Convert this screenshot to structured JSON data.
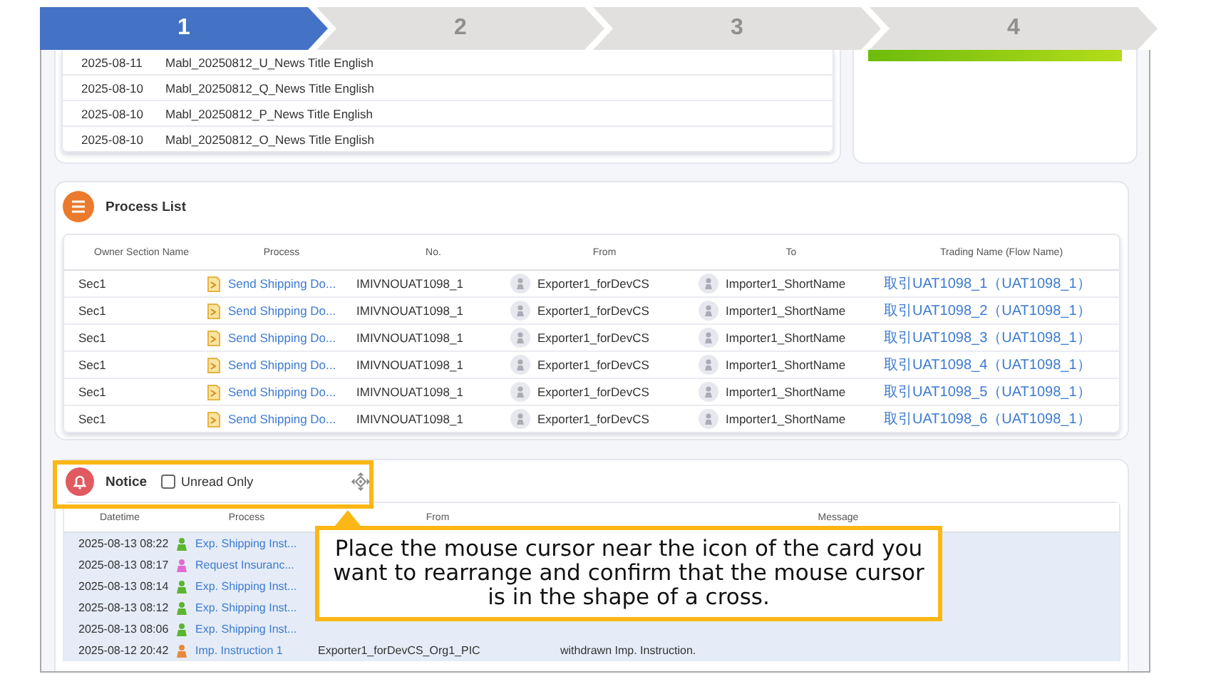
{
  "steps": [
    {
      "label": "1",
      "selected": true
    },
    {
      "label": "2",
      "selected": false
    },
    {
      "label": "3",
      "selected": false
    },
    {
      "label": "4",
      "selected": false
    }
  ],
  "news_card": {
    "rows": [
      {
        "date": "2025-08-11",
        "title": "Mabl_20250812_U_News Title English"
      },
      {
        "date": "2025-08-10",
        "title": "Mabl_20250812_Q_News Title English"
      },
      {
        "date": "2025-08-10",
        "title": "Mabl_20250812_P_News Title English"
      },
      {
        "date": "2025-08-10",
        "title": "Mabl_20250812_O_News Title English"
      }
    ]
  },
  "process_list": {
    "title": "Process List",
    "columns": [
      "Owner Section Name",
      "Process",
      "No.",
      "From",
      "To",
      "Trading Name (Flow Name)"
    ],
    "rows": [
      {
        "owner": "Sec1",
        "process": "Send Shipping Do...",
        "no": "IMIVNOUAT1098_1",
        "from": "Exporter1_forDevCS",
        "to": "Importer1_ShortName",
        "trading": "取引UAT1098_1（UAT1098_1）"
      },
      {
        "owner": "Sec1",
        "process": "Send Shipping Do...",
        "no": "IMIVNOUAT1098_1",
        "from": "Exporter1_forDevCS",
        "to": "Importer1_ShortName",
        "trading": "取引UAT1098_2（UAT1098_1）"
      },
      {
        "owner": "Sec1",
        "process": "Send Shipping Do...",
        "no": "IMIVNOUAT1098_1",
        "from": "Exporter1_forDevCS",
        "to": "Importer1_ShortName",
        "trading": "取引UAT1098_3（UAT1098_1）"
      },
      {
        "owner": "Sec1",
        "process": "Send Shipping Do...",
        "no": "IMIVNOUAT1098_1",
        "from": "Exporter1_forDevCS",
        "to": "Importer1_ShortName",
        "trading": "取引UAT1098_4（UAT1098_1）"
      },
      {
        "owner": "Sec1",
        "process": "Send Shipping Do...",
        "no": "IMIVNOUAT1098_1",
        "from": "Exporter1_forDevCS",
        "to": "Importer1_ShortName",
        "trading": "取引UAT1098_5（UAT1098_1）"
      },
      {
        "owner": "Sec1",
        "process": "Send Shipping Do...",
        "no": "IMIVNOUAT1098_1",
        "from": "Exporter1_forDevCS",
        "to": "Importer1_ShortName",
        "trading": "取引UAT1098_6（UAT1098_1）"
      }
    ]
  },
  "notice": {
    "title": "Notice",
    "unread_only": {
      "label": "Unread Only",
      "checked": false
    },
    "columns": [
      "Datetime",
      "Process",
      "From",
      "Message"
    ],
    "rows": [
      {
        "datetime": "2025-08-13 08:22",
        "process": "Exp. Shipping Inst...",
        "color": "#5cb531"
      },
      {
        "datetime": "2025-08-13 08:17",
        "process": "Request Insuranc...",
        "color": "#e26ad0"
      },
      {
        "datetime": "2025-08-13 08:14",
        "process": "Exp. Shipping Inst...",
        "color": "#5cb531"
      },
      {
        "datetime": "2025-08-13 08:12",
        "process": "Exp. Shipping Inst...",
        "color": "#5cb531"
      },
      {
        "datetime": "2025-08-13 08:06",
        "process": "Exp. Shipping Inst...",
        "color": "#5cb531"
      },
      {
        "datetime": "2025-08-12 20:42",
        "process": "Imp. Instruction 1",
        "color": "#e8893a",
        "from": "Exporter1_forDevCS_Org1_PIC",
        "message": "withdrawn Imp. Instruction."
      }
    ]
  },
  "callout": {
    "text": "Place the mouse cursor near the icon of the card you want to rearrange and confirm that the mouse cursor is in the shape of a cross."
  }
}
